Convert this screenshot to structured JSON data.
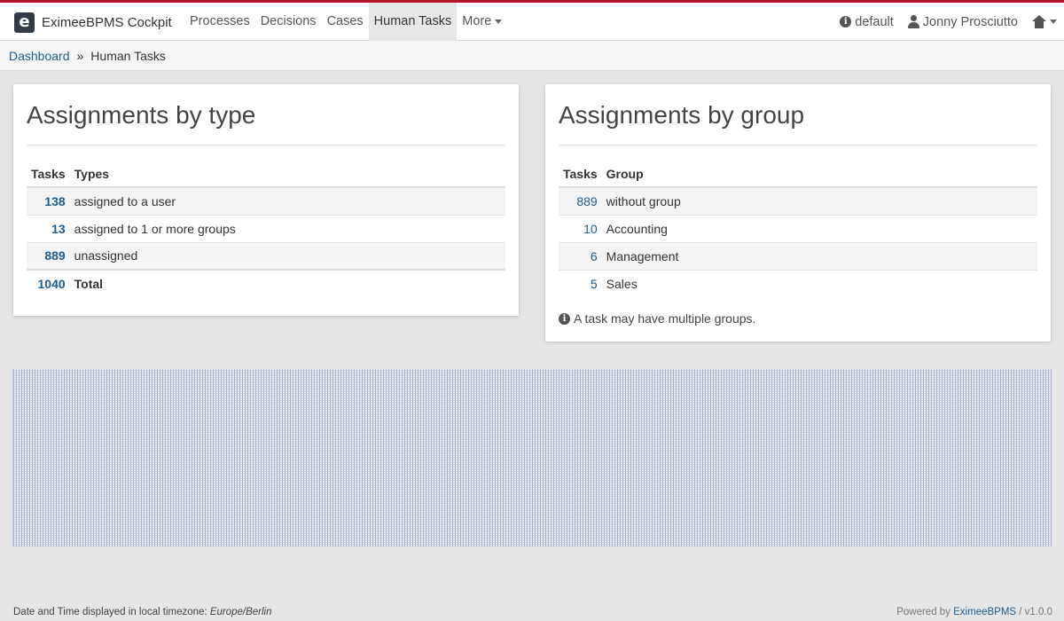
{
  "navbar": {
    "brand_logo": "e",
    "brand_name": "EximeeBPMS Cockpit",
    "items": [
      {
        "label": "Processes",
        "active": false
      },
      {
        "label": "Decisions",
        "active": false
      },
      {
        "label": "Cases",
        "active": false
      },
      {
        "label": "Human Tasks",
        "active": true
      },
      {
        "label": "More",
        "active": false
      }
    ],
    "engine_label": "default",
    "user_name": "Jonny Prosciutto",
    "accent_color": "#b5152b"
  },
  "breadcrumb": {
    "home": "Dashboard",
    "separator": "»",
    "current": "Human Tasks"
  },
  "by_type": {
    "title": "Assignments by type",
    "col_tasks": "Tasks",
    "col_types": "Types",
    "rows": [
      {
        "tasks": "138",
        "label": "assigned to a user"
      },
      {
        "tasks": "13",
        "label": "assigned to 1 or more groups"
      },
      {
        "tasks": "889",
        "label": "unassigned"
      }
    ],
    "total": {
      "tasks": "1040",
      "label": "Total"
    }
  },
  "by_group": {
    "title": "Assignments by group",
    "col_tasks": "Tasks",
    "col_group": "Group",
    "rows": [
      {
        "tasks": "889",
        "label": "without group"
      },
      {
        "tasks": "10",
        "label": "Accounting"
      },
      {
        "tasks": "6",
        "label": "Management"
      },
      {
        "tasks": "5",
        "label": "Sales"
      }
    ],
    "note": "A task may have multiple groups."
  },
  "footer": {
    "timezone_prefix": "Date and Time displayed in local timezone: ",
    "timezone": "Europe/Berlin",
    "powered_prefix": "Powered by ",
    "powered_link": "EximeeBPMS",
    "version": " / v1.0.0"
  }
}
